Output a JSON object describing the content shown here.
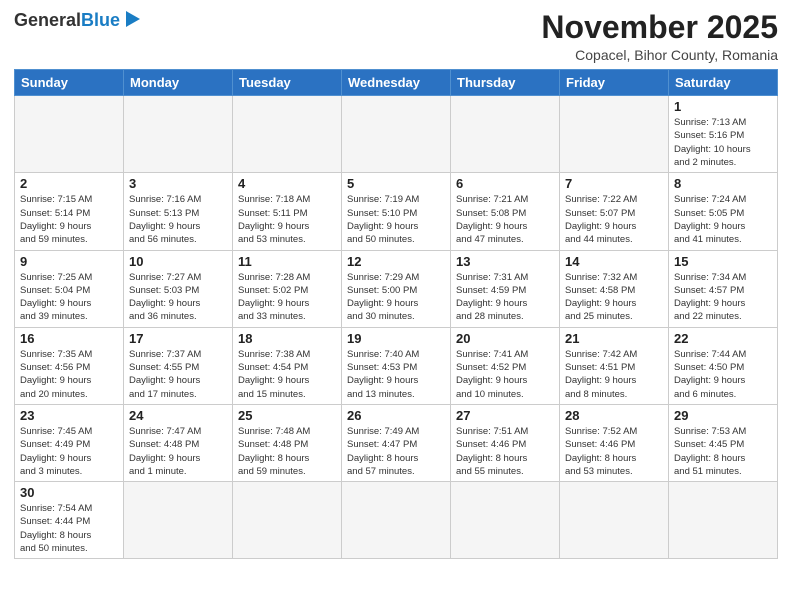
{
  "header": {
    "logo_main": "General",
    "logo_accent": "Blue",
    "month_title": "November 2025",
    "location": "Copacel, Bihor County, Romania"
  },
  "weekdays": [
    "Sunday",
    "Monday",
    "Tuesday",
    "Wednesday",
    "Thursday",
    "Friday",
    "Saturday"
  ],
  "weeks": [
    [
      {
        "day": "",
        "info": ""
      },
      {
        "day": "",
        "info": ""
      },
      {
        "day": "",
        "info": ""
      },
      {
        "day": "",
        "info": ""
      },
      {
        "day": "",
        "info": ""
      },
      {
        "day": "",
        "info": ""
      },
      {
        "day": "1",
        "info": "Sunrise: 7:13 AM\nSunset: 5:16 PM\nDaylight: 10 hours\nand 2 minutes."
      }
    ],
    [
      {
        "day": "2",
        "info": "Sunrise: 7:15 AM\nSunset: 5:14 PM\nDaylight: 9 hours\nand 59 minutes."
      },
      {
        "day": "3",
        "info": "Sunrise: 7:16 AM\nSunset: 5:13 PM\nDaylight: 9 hours\nand 56 minutes."
      },
      {
        "day": "4",
        "info": "Sunrise: 7:18 AM\nSunset: 5:11 PM\nDaylight: 9 hours\nand 53 minutes."
      },
      {
        "day": "5",
        "info": "Sunrise: 7:19 AM\nSunset: 5:10 PM\nDaylight: 9 hours\nand 50 minutes."
      },
      {
        "day": "6",
        "info": "Sunrise: 7:21 AM\nSunset: 5:08 PM\nDaylight: 9 hours\nand 47 minutes."
      },
      {
        "day": "7",
        "info": "Sunrise: 7:22 AM\nSunset: 5:07 PM\nDaylight: 9 hours\nand 44 minutes."
      },
      {
        "day": "8",
        "info": "Sunrise: 7:24 AM\nSunset: 5:05 PM\nDaylight: 9 hours\nand 41 minutes."
      }
    ],
    [
      {
        "day": "9",
        "info": "Sunrise: 7:25 AM\nSunset: 5:04 PM\nDaylight: 9 hours\nand 39 minutes."
      },
      {
        "day": "10",
        "info": "Sunrise: 7:27 AM\nSunset: 5:03 PM\nDaylight: 9 hours\nand 36 minutes."
      },
      {
        "day": "11",
        "info": "Sunrise: 7:28 AM\nSunset: 5:02 PM\nDaylight: 9 hours\nand 33 minutes."
      },
      {
        "day": "12",
        "info": "Sunrise: 7:29 AM\nSunset: 5:00 PM\nDaylight: 9 hours\nand 30 minutes."
      },
      {
        "day": "13",
        "info": "Sunrise: 7:31 AM\nSunset: 4:59 PM\nDaylight: 9 hours\nand 28 minutes."
      },
      {
        "day": "14",
        "info": "Sunrise: 7:32 AM\nSunset: 4:58 PM\nDaylight: 9 hours\nand 25 minutes."
      },
      {
        "day": "15",
        "info": "Sunrise: 7:34 AM\nSunset: 4:57 PM\nDaylight: 9 hours\nand 22 minutes."
      }
    ],
    [
      {
        "day": "16",
        "info": "Sunrise: 7:35 AM\nSunset: 4:56 PM\nDaylight: 9 hours\nand 20 minutes."
      },
      {
        "day": "17",
        "info": "Sunrise: 7:37 AM\nSunset: 4:55 PM\nDaylight: 9 hours\nand 17 minutes."
      },
      {
        "day": "18",
        "info": "Sunrise: 7:38 AM\nSunset: 4:54 PM\nDaylight: 9 hours\nand 15 minutes."
      },
      {
        "day": "19",
        "info": "Sunrise: 7:40 AM\nSunset: 4:53 PM\nDaylight: 9 hours\nand 13 minutes."
      },
      {
        "day": "20",
        "info": "Sunrise: 7:41 AM\nSunset: 4:52 PM\nDaylight: 9 hours\nand 10 minutes."
      },
      {
        "day": "21",
        "info": "Sunrise: 7:42 AM\nSunset: 4:51 PM\nDaylight: 9 hours\nand 8 minutes."
      },
      {
        "day": "22",
        "info": "Sunrise: 7:44 AM\nSunset: 4:50 PM\nDaylight: 9 hours\nand 6 minutes."
      }
    ],
    [
      {
        "day": "23",
        "info": "Sunrise: 7:45 AM\nSunset: 4:49 PM\nDaylight: 9 hours\nand 3 minutes."
      },
      {
        "day": "24",
        "info": "Sunrise: 7:47 AM\nSunset: 4:48 PM\nDaylight: 9 hours\nand 1 minute."
      },
      {
        "day": "25",
        "info": "Sunrise: 7:48 AM\nSunset: 4:48 PM\nDaylight: 8 hours\nand 59 minutes."
      },
      {
        "day": "26",
        "info": "Sunrise: 7:49 AM\nSunset: 4:47 PM\nDaylight: 8 hours\nand 57 minutes."
      },
      {
        "day": "27",
        "info": "Sunrise: 7:51 AM\nSunset: 4:46 PM\nDaylight: 8 hours\nand 55 minutes."
      },
      {
        "day": "28",
        "info": "Sunrise: 7:52 AM\nSunset: 4:46 PM\nDaylight: 8 hours\nand 53 minutes."
      },
      {
        "day": "29",
        "info": "Sunrise: 7:53 AM\nSunset: 4:45 PM\nDaylight: 8 hours\nand 51 minutes."
      }
    ],
    [
      {
        "day": "30",
        "info": "Sunrise: 7:54 AM\nSunset: 4:44 PM\nDaylight: 8 hours\nand 50 minutes."
      },
      {
        "day": "",
        "info": ""
      },
      {
        "day": "",
        "info": ""
      },
      {
        "day": "",
        "info": ""
      },
      {
        "day": "",
        "info": ""
      },
      {
        "day": "",
        "info": ""
      },
      {
        "day": "",
        "info": ""
      }
    ]
  ]
}
